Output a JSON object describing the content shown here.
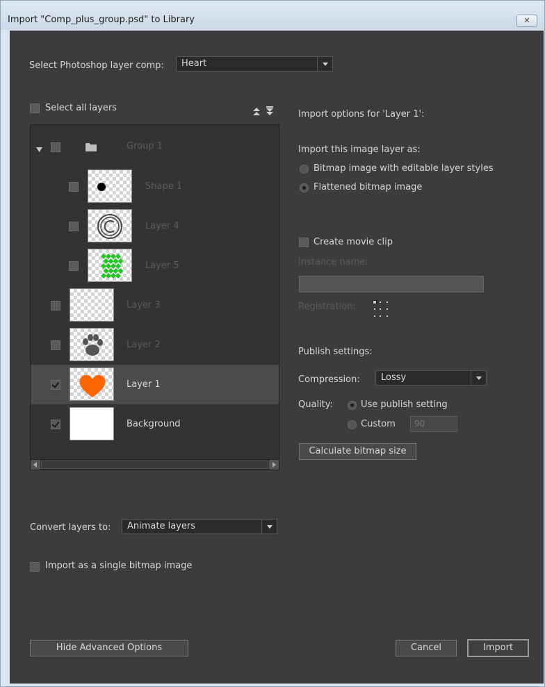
{
  "window": {
    "title": "Import \"Comp_plus_group.psd\" to Library",
    "close_glyph": "✕"
  },
  "layer_comp": {
    "label": "Select Photoshop layer comp:",
    "value": "Heart"
  },
  "select_all": {
    "label": "Select all layers",
    "checked": false
  },
  "layers": [
    {
      "name": "Group 1",
      "type": "group",
      "checked": false,
      "dimmed": true,
      "expanded": true
    },
    {
      "name": "Shape 1",
      "thumb": "black-dot",
      "checked": false,
      "dimmed": true
    },
    {
      "name": "Layer 4",
      "thumb": "copyright",
      "checked": false,
      "dimmed": true
    },
    {
      "name": "Layer 5",
      "thumb": "green-diamonds",
      "checked": false,
      "dimmed": true
    },
    {
      "name": "Layer 3",
      "thumb": "empty",
      "checked": false,
      "dimmed": true
    },
    {
      "name": "Layer 2",
      "thumb": "paw",
      "checked": false,
      "dimmed": true
    },
    {
      "name": "Layer 1",
      "thumb": "orange-heart",
      "checked": true,
      "dimmed": false,
      "selected": true
    },
    {
      "name": "Background",
      "thumb": "white",
      "checked": true,
      "dimmed": false
    }
  ],
  "convert": {
    "label": "Convert layers to:",
    "value": "Animate layers"
  },
  "single_bitmap": {
    "label": "Import as a single bitmap image",
    "checked": false
  },
  "options": {
    "header": "Import options for 'Layer 1':",
    "import_as_label": "Import this image layer as:",
    "bitmap_editable": "Bitmap image with editable layer styles",
    "flattened": "Flattened bitmap image",
    "flattened_selected": true,
    "create_movie_clip": "Create movie clip",
    "instance_name_label": "Instance name:",
    "registration_label": "Registration:"
  },
  "publish": {
    "header": "Publish settings:",
    "compression_label": "Compression:",
    "compression_value": "Lossy",
    "quality_label": "Quality:",
    "use_publish": "Use publish setting",
    "custom": "Custom",
    "custom_value": "90",
    "calc_button": "Calculate bitmap size"
  },
  "footer": {
    "hide_advanced": "Hide Advanced Options",
    "cancel": "Cancel",
    "import": "Import"
  },
  "colors": {
    "dialog_bg": "#3c3c3c",
    "heart": "#ff6600",
    "diamonds": "#22c822"
  }
}
